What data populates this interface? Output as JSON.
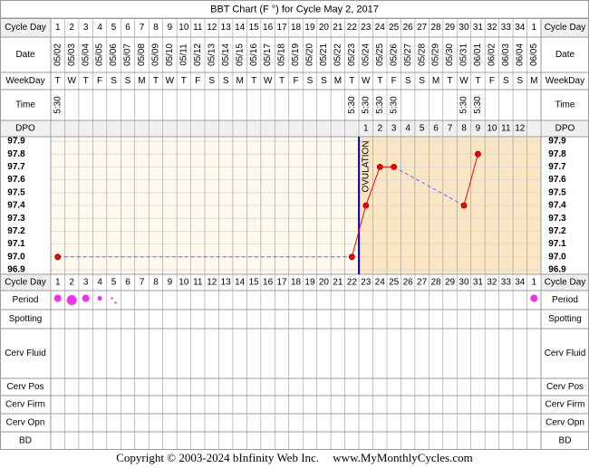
{
  "title": "BBT Chart (F °) for Cycle May 2, 2017",
  "row_labels": {
    "cycle_day": "Cycle Day",
    "date": "Date",
    "weekday": "WeekDay",
    "time": "Time",
    "dpo": "DPO",
    "period": "Period",
    "spotting": "Spotting",
    "cerv_fluid": "Cerv Fluid",
    "cerv_pos": "Cerv Pos",
    "cerv_firm": "Cerv Firm",
    "cerv_opn": "Cerv Opn",
    "bd": "BD"
  },
  "days": [
    "1",
    "2",
    "3",
    "4",
    "5",
    "6",
    "7",
    "8",
    "9",
    "10",
    "11",
    "12",
    "13",
    "14",
    "15",
    "16",
    "17",
    "18",
    "19",
    "20",
    "21",
    "22",
    "23",
    "24",
    "25",
    "26",
    "27",
    "28",
    "29",
    "30",
    "31",
    "32",
    "33",
    "34",
    "1"
  ],
  "dates": [
    "05/02",
    "05/03",
    "05/04",
    "05/05",
    "05/06",
    "05/07",
    "05/08",
    "05/09",
    "05/10",
    "05/11",
    "05/12",
    "05/13",
    "05/14",
    "05/15",
    "05/16",
    "05/17",
    "05/18",
    "05/19",
    "05/20",
    "05/21",
    "05/22",
    "05/23",
    "05/24",
    "05/25",
    "05/26",
    "05/27",
    "05/28",
    "05/29",
    "05/30",
    "05/31",
    "06/01",
    "06/02",
    "06/03",
    "06/04",
    "06/05"
  ],
  "weekdays": [
    "T",
    "W",
    "T",
    "F",
    "S",
    "S",
    "M",
    "T",
    "W",
    "T",
    "F",
    "S",
    "S",
    "M",
    "T",
    "W",
    "T",
    "F",
    "S",
    "S",
    "M",
    "T",
    "W",
    "T",
    "F",
    "S",
    "S",
    "M",
    "T",
    "W",
    "T",
    "F",
    "S",
    "S",
    "M"
  ],
  "times": [
    "5:30",
    "",
    "",
    "",
    "",
    "",
    "",
    "",
    "",
    "",
    "",
    "",
    "",
    "",
    "",
    "",
    "",
    "",
    "",
    "",
    "",
    "5:30",
    "5:30",
    "5:30",
    "5:30",
    "",
    "",
    "",
    "",
    "5:30",
    "5:30",
    "",
    "",
    "",
    ""
  ],
  "dpo": [
    "",
    "",
    "",
    "",
    "",
    "",
    "",
    "",
    "",
    "",
    "",
    "",
    "",
    "",
    "",
    "",
    "",
    "",
    "",
    "",
    "",
    "",
    "1",
    "2",
    "3",
    "4",
    "5",
    "6",
    "7",
    "8",
    "9",
    "10",
    "11",
    "12",
    ""
  ],
  "temp_labels": [
    "97.9",
    "97.8",
    "97.7",
    "97.6",
    "97.5",
    "97.4",
    "97.3",
    "97.2",
    "97.1",
    "97.0",
    "96.9"
  ],
  "ovulation_label": "OVULATION",
  "ovulation_day_index": 21,
  "period": [
    2,
    3,
    2,
    1,
    0.5,
    0,
    0,
    0,
    0,
    0,
    0,
    0,
    0,
    0,
    0,
    0,
    0,
    0,
    0,
    0,
    0,
    0,
    0,
    0,
    0,
    0,
    0,
    0,
    0,
    0,
    0,
    0,
    0,
    0,
    2
  ],
  "colors": {
    "border": "#999999",
    "header_bg": "#f0f0f0",
    "chart_pre_bg": "#fdf9ed",
    "chart_post_bg": "#fbe6c4",
    "grid": "#d8d8d8",
    "line": "#ff0000",
    "point": "#ff0000",
    "dashed": "#6666ff",
    "ovulation": "#0000ff",
    "period": "#ee33ee"
  },
  "chart_data": {
    "type": "line",
    "title": "BBT Chart (F °) for Cycle May 2, 2017",
    "x": [
      1,
      22,
      23,
      24,
      25,
      30,
      31
    ],
    "y": [
      97.0,
      97.0,
      97.4,
      97.7,
      97.7,
      97.4,
      97.8
    ],
    "ylim": [
      96.9,
      97.9
    ],
    "ylabel": "",
    "xlabel": "Cycle Day",
    "grid": true
  },
  "copyright": {
    "text": "Copyright © 2003-2024 bInfinity Web Inc.",
    "site": "www.MyMonthlyCycles.com"
  }
}
